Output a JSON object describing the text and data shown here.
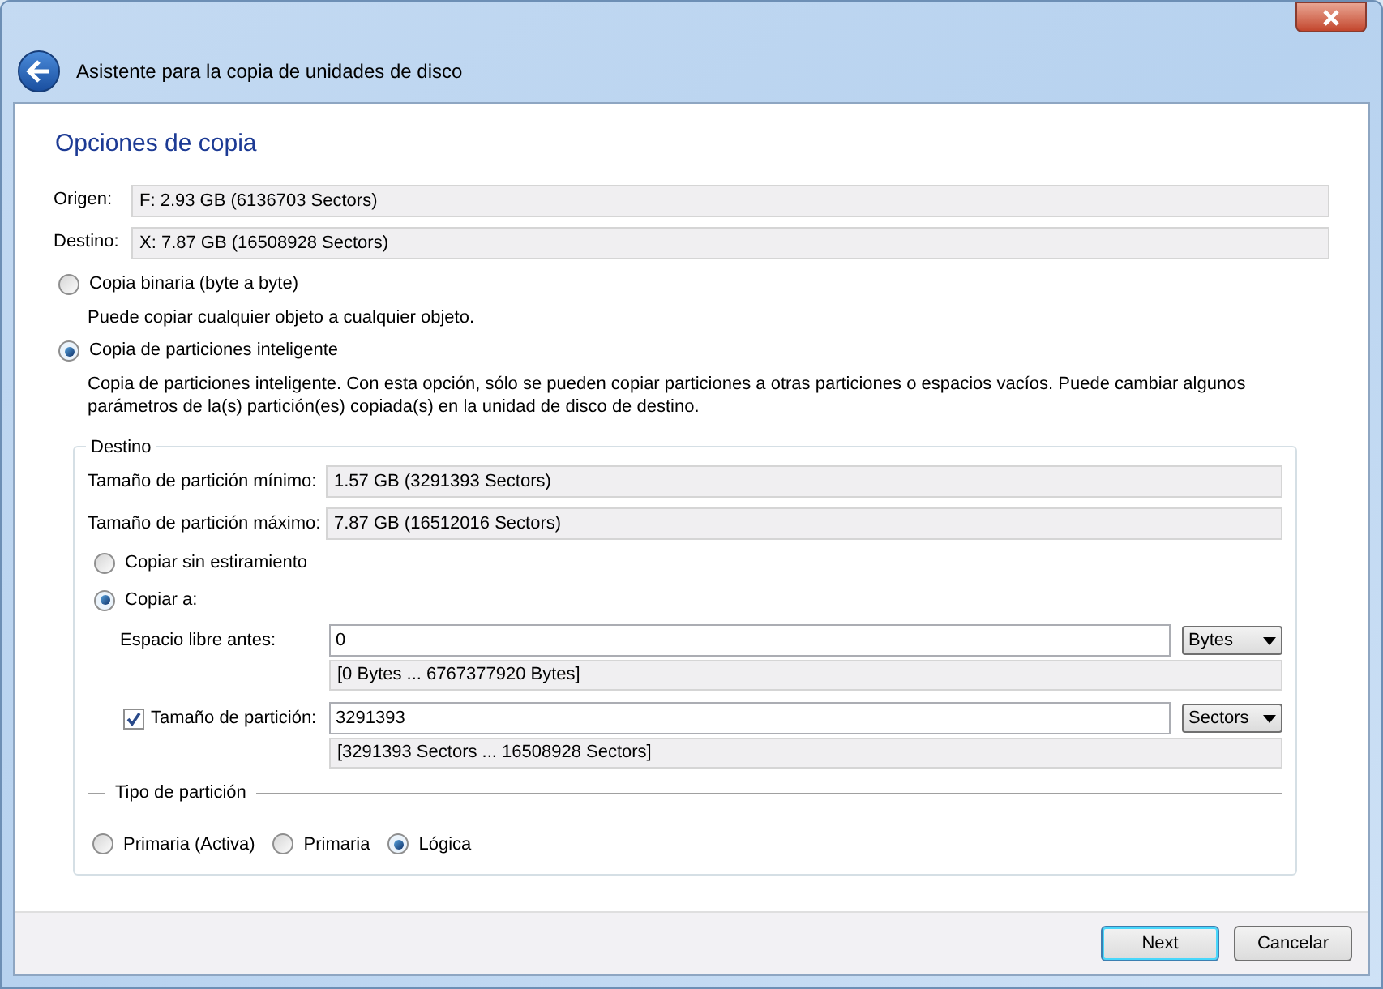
{
  "window": {
    "title": "Asistente para la copia de unidades de disco"
  },
  "heading": "Opciones de copia",
  "info_fields": [
    {
      "label": "Origen:",
      "value": "F: 2.93 GB (6136703 Sectors)"
    },
    {
      "label": "Destino:",
      "value": "X: 7.87 GB (16508928 Sectors)"
    }
  ],
  "copy_modes": [
    {
      "label": "Copia binaria (byte a byte)",
      "description": "Puede copiar cualquier objeto a cualquier objeto.",
      "selected": false
    },
    {
      "label": "Copia de particiones inteligente",
      "description": "Copia de particiones inteligente. Con esta opción, sólo se pueden copiar particiones a otras particiones o espacios vacíos. Puede cambiar algunos parámetros de la(s) partición(es) copiada(s) en la unidad de disco de destino.",
      "selected": true
    }
  ],
  "destination_group": {
    "title": "Destino",
    "info_fields": [
      {
        "label": "Tamaño de partición mínimo:",
        "value": "1.57 GB (3291393 Sectors)"
      },
      {
        "label": "Tamaño de partición máximo:",
        "value": "7.87 GB (16512016 Sectors)"
      }
    ],
    "resize_modes": [
      {
        "label": "Copiar sin estiramiento",
        "selected": false
      },
      {
        "label": "Copiar a:",
        "selected": true
      }
    ],
    "size_fields": [
      {
        "kind": "plain",
        "label": "Espacio libre antes:",
        "value": "0",
        "unit": "Bytes",
        "range": "[0 Bytes ... 6767377920 Bytes]"
      },
      {
        "kind": "checkbox",
        "label": "Tamaño de partición:",
        "checked": true,
        "value": "3291393",
        "unit": "Sectors",
        "range": "[3291393 Sectors ... 16508928 Sectors]"
      }
    ],
    "partition_type": {
      "title": "Tipo de partición",
      "options": [
        {
          "label": "Primaria (Activa)",
          "selected": false
        },
        {
          "label": "Primaria",
          "selected": false
        },
        {
          "label": "Lógica",
          "selected": true
        }
      ]
    }
  },
  "buttons": [
    {
      "label": "Next",
      "default": true
    },
    {
      "label": "Cancelar",
      "default": false
    }
  ]
}
